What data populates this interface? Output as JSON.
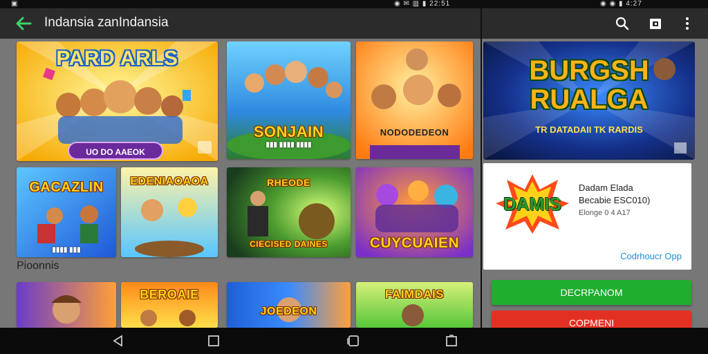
{
  "status": {
    "left": "▣",
    "right_left": "◉ ✉ ▥ ▮ 22:51",
    "right_right": "◉ ◉ ▮ 4:27"
  },
  "toolbar": {
    "title": "Indansia zanIndansia"
  },
  "grid": {
    "row1": [
      {
        "title": "PARD ARLS",
        "button": "UO DO AAEOK",
        "colors": [
          "#ffe33a",
          "#f6a800"
        ]
      },
      {
        "title": "SONJAIN",
        "colors": [
          "#45b4ff",
          "#2b7c2e"
        ]
      },
      {
        "title": "NODODEDEON",
        "colors": [
          "#ffcf3d",
          "#ff7a10"
        ]
      }
    ],
    "row2": [
      {
        "title": "GACAZLIN",
        "colors": [
          "#39a9ff",
          "#1f58d8"
        ]
      },
      {
        "title": "EDENIAOAOA",
        "colors": [
          "#ffd65a",
          "#58c6ff"
        ]
      },
      {
        "title": "RHEODE",
        "subtitle": "CIECISED DAINES",
        "colors": [
          "#2a6a30",
          "#a3e14a"
        ]
      },
      {
        "title": "CUYCUAIEN",
        "colors": [
          "#7b2fc8",
          "#ff7a20"
        ]
      }
    ],
    "row3": [
      {
        "title": "",
        "colors": [
          "#6a3cc9",
          "#ff9f3a"
        ]
      },
      {
        "title": "BEROAIE",
        "colors": [
          "#ff8a1a",
          "#ffdf4a"
        ]
      },
      {
        "title": "JOEDEON",
        "colors": [
          "#1f5fd6",
          "#ff9f3a"
        ]
      },
      {
        "title": "FAIMDAIS",
        "colors": [
          "#57c63a",
          "#d6f07a"
        ]
      }
    ]
  },
  "section": {
    "title": "Pioonnis"
  },
  "right": {
    "banner": {
      "line1": "BURGSH",
      "line2": "RUALGA",
      "sub": "TR DATADAII TK RARDIS"
    },
    "info": {
      "logo": "DAMIS",
      "line1": "Dadam Elada",
      "line2": "Becabie ESC010)",
      "line3": "Elonge 0 4 A17",
      "link": "Codrhoucr Opp"
    },
    "primary_button": "DECRPANOM",
    "secondary_button": "COPMENI",
    "primary_color": "#1fae2e",
    "secondary_color": "#e23123"
  }
}
